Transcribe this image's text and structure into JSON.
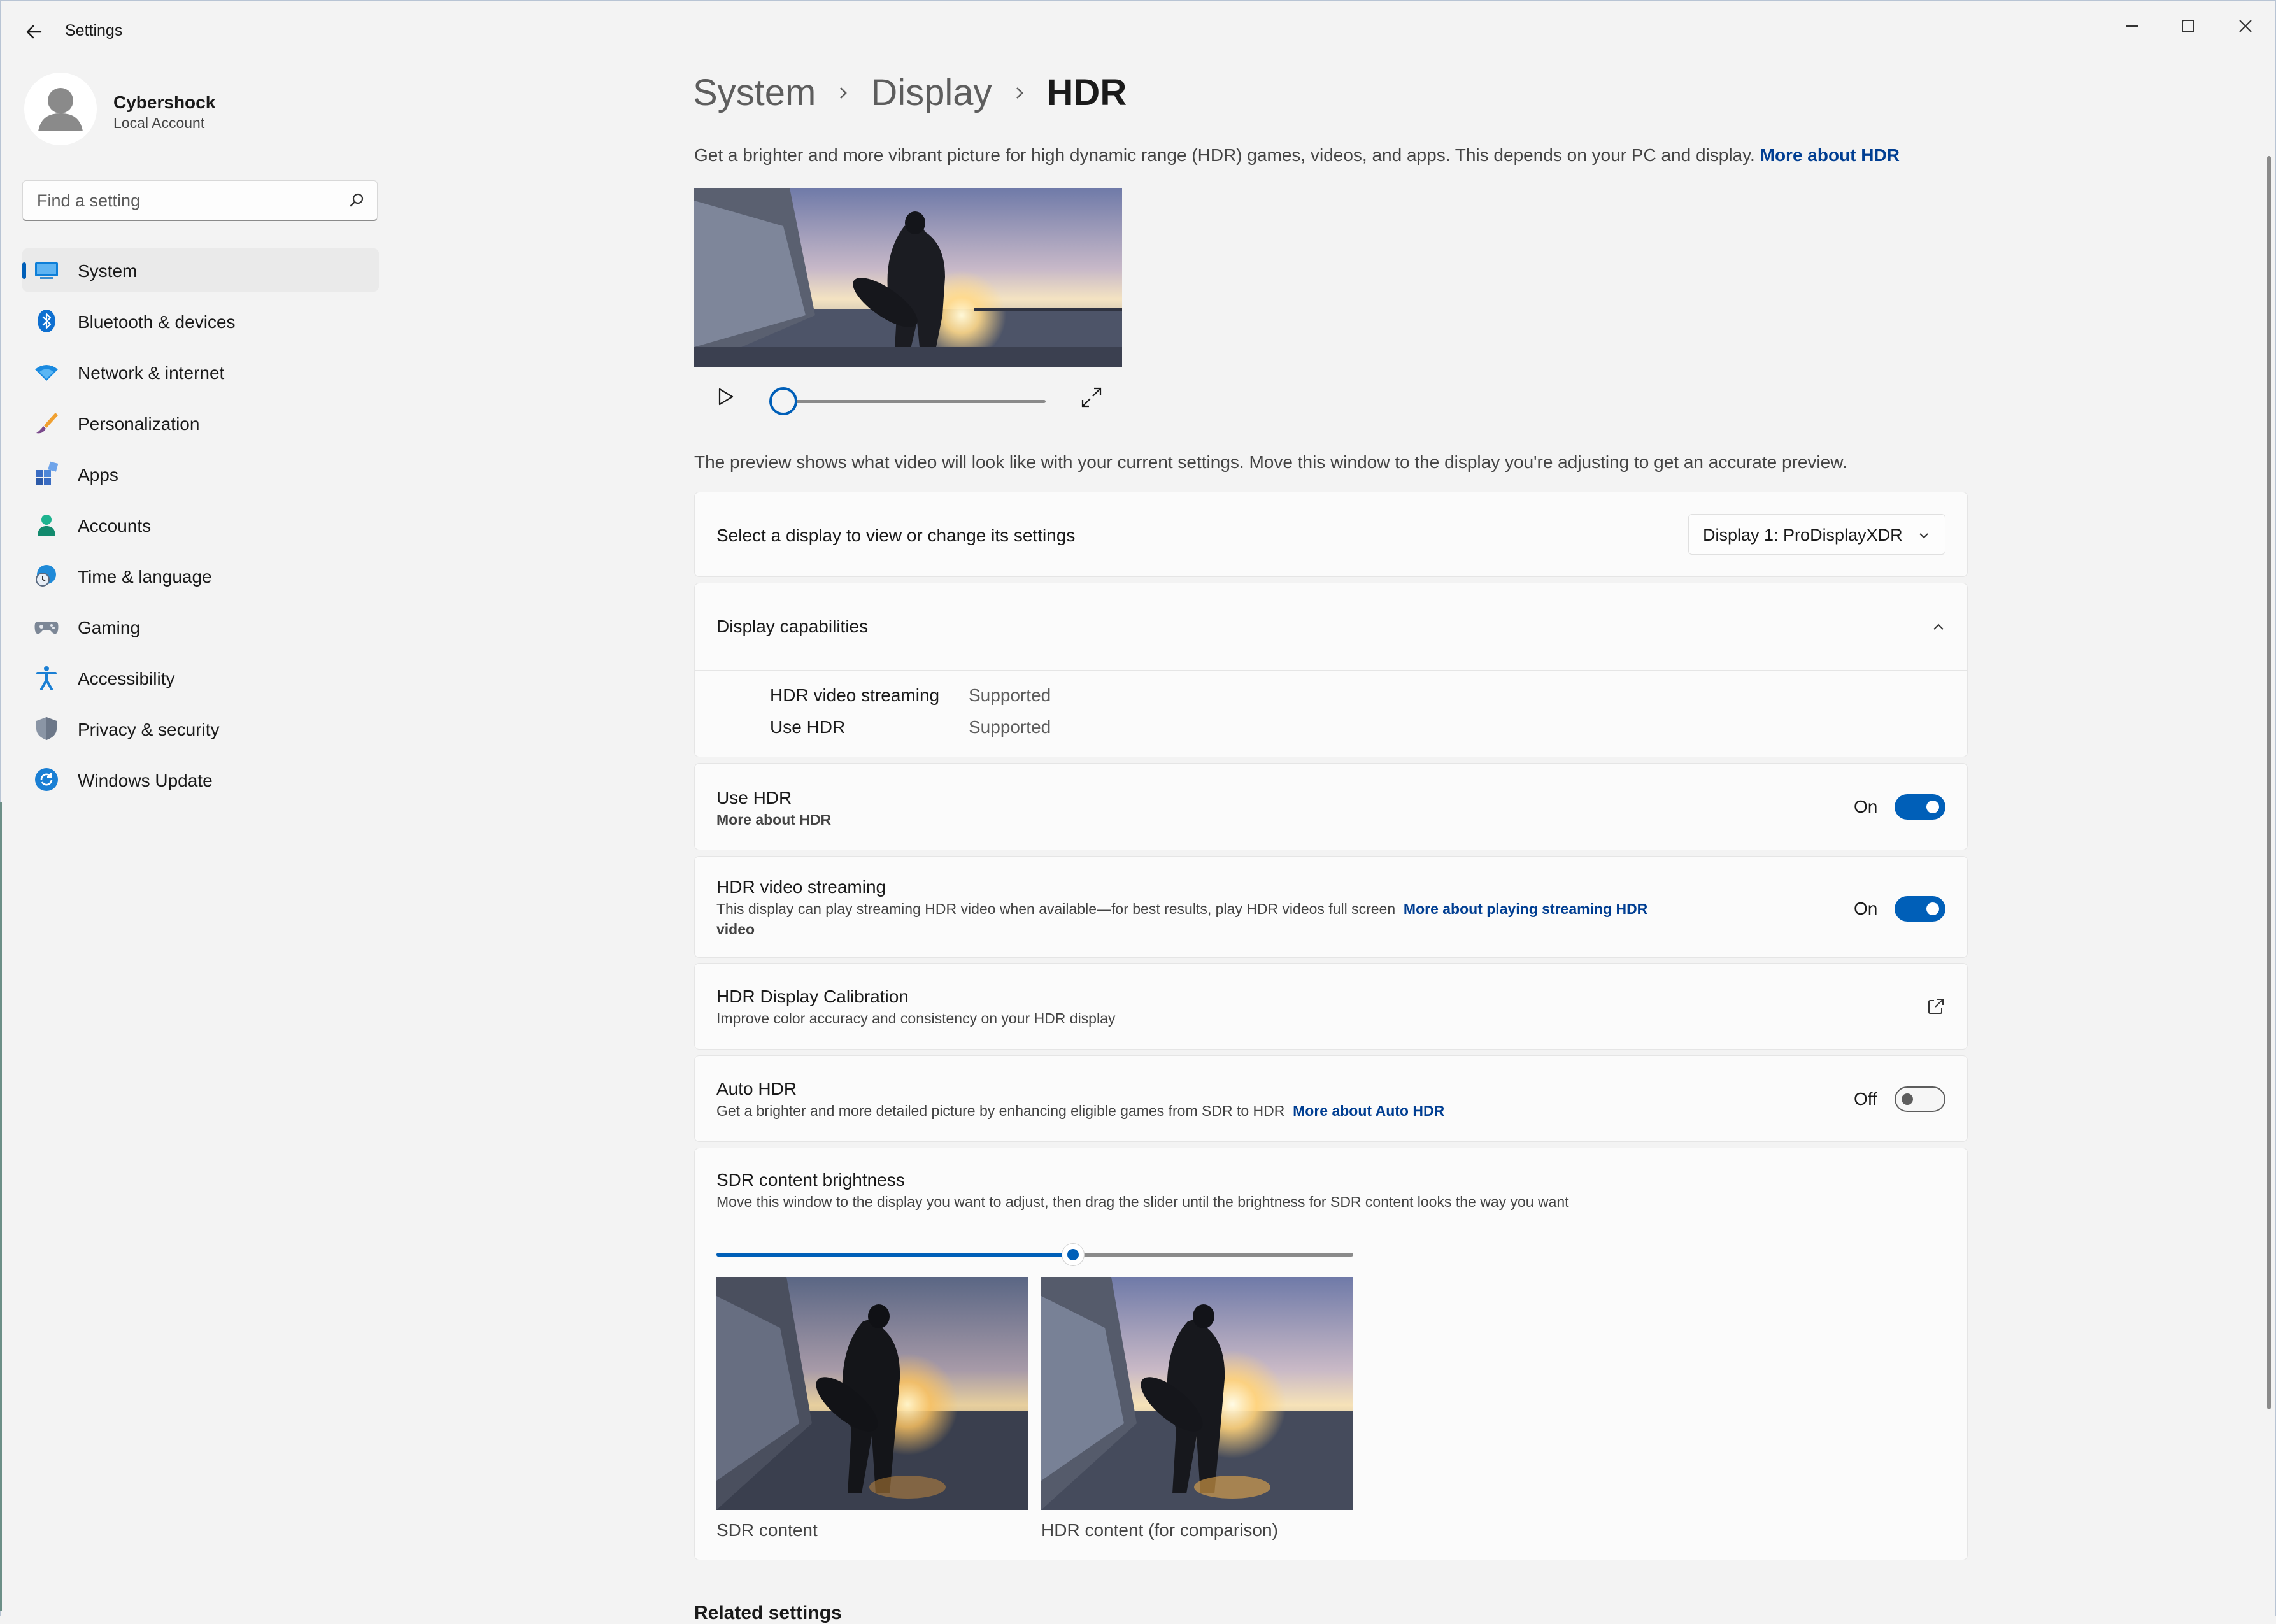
{
  "window": {
    "title": "Settings"
  },
  "user": {
    "name": "Cybershock",
    "account_type": "Local Account"
  },
  "search": {
    "placeholder": "Find a setting"
  },
  "sidebar": {
    "items": [
      {
        "label": "System",
        "icon": "system-icon",
        "active": true
      },
      {
        "label": "Bluetooth & devices",
        "icon": "bluetooth-icon"
      },
      {
        "label": "Network & internet",
        "icon": "wifi-icon"
      },
      {
        "label": "Personalization",
        "icon": "brush-icon"
      },
      {
        "label": "Apps",
        "icon": "apps-icon"
      },
      {
        "label": "Accounts",
        "icon": "accounts-icon"
      },
      {
        "label": "Time & language",
        "icon": "globe-clock-icon"
      },
      {
        "label": "Gaming",
        "icon": "gamepad-icon"
      },
      {
        "label": "Accessibility",
        "icon": "accessibility-icon"
      },
      {
        "label": "Privacy & security",
        "icon": "shield-icon"
      },
      {
        "label": "Windows Update",
        "icon": "update-icon"
      }
    ]
  },
  "breadcrumb": {
    "items": [
      "System",
      "Display",
      "HDR"
    ]
  },
  "intro": {
    "text": "Get a brighter and more vibrant picture for high dynamic range (HDR) games, videos, and apps. This depends on your PC and display.",
    "link": "More about HDR"
  },
  "preview": {
    "seek_progress": 0.0,
    "note": "The preview shows what video will look like with your current settings. Move this window to the display you're adjusting to get an accurate preview."
  },
  "display_select": {
    "label": "Select a display to view or change its settings",
    "value": "Display 1: ProDisplayXDR"
  },
  "capabilities": {
    "title": "Display capabilities",
    "rows": [
      {
        "name": "HDR video streaming",
        "value": "Supported"
      },
      {
        "name": "Use HDR",
        "value": "Supported"
      }
    ]
  },
  "use_hdr": {
    "title": "Use HDR",
    "link": "More about HDR",
    "state": "On"
  },
  "hdr_streaming": {
    "title": "HDR video streaming",
    "desc": "This display can play streaming HDR video when available—for best results, play HDR videos full screen",
    "link_line1": "More about playing streaming HDR",
    "link_line2": "video",
    "state": "On"
  },
  "calibration": {
    "title": "HDR Display Calibration",
    "desc": "Improve color accuracy and consistency on your HDR display"
  },
  "auto_hdr": {
    "title": "Auto HDR",
    "desc": "Get a brighter and more detailed picture by enhancing eligible games from SDR to HDR",
    "link": "More about Auto HDR",
    "state": "Off"
  },
  "sdr_brightness": {
    "title": "SDR content brightness",
    "desc": "Move this window to the display you want to adjust, then drag the slider until the brightness for SDR content looks the way you want",
    "value": 0.56,
    "sdr_caption": "SDR content",
    "hdr_caption": "HDR content (for comparison)"
  },
  "related": {
    "title": "Related settings"
  },
  "colors": {
    "accent": "#005fb8",
    "link": "#003e92"
  }
}
